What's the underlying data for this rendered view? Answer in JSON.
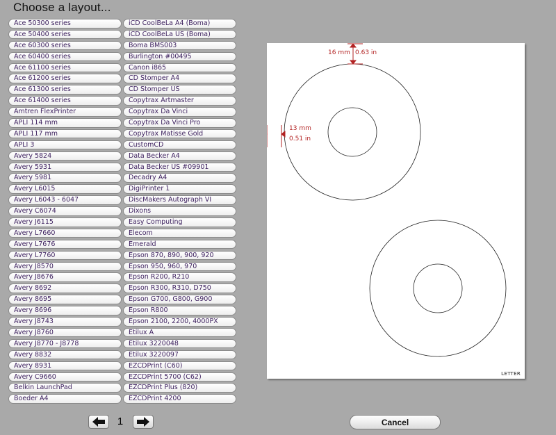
{
  "header": {
    "title": "Choose a layout..."
  },
  "layouts": {
    "column1": [
      "Ace 50300 series",
      "Ace 50400 series",
      "Ace 60300 series",
      "Ace 60400 series",
      "Ace 61100 series",
      "Ace 61200 series",
      "Ace 61300 series",
      "Ace 61400 series",
      "Amtren FlexPrinter",
      "APLI 114 mm",
      "APLI 117 mm",
      "APLI 3",
      "Avery 5824",
      "Avery 5931",
      "Avery 5981",
      "Avery L6015",
      "Avery L6043 - 6047",
      "Avery C6074",
      "Avery J6115",
      "Avery L7660",
      "Avery L7676",
      "Avery L7760",
      "Avery J8570",
      "Avery J8676",
      "Avery 8692",
      "Avery 8695",
      "Avery 8696",
      "Avery J8743",
      "Avery J8760",
      "Avery J8770 - J8778",
      "Avery 8832",
      "Avery 8931",
      "Avery C9660",
      "Belkin LaunchPad",
      "Boeder A4"
    ],
    "column2": [
      "iCD CoolBeLa A4 (Boma)",
      "iCD CoolBeLa US (Boma)",
      "Boma BMS003",
      "Burlington #00495",
      "Canon i865",
      "CD Stomper A4",
      "CD Stomper US",
      "Copytrax Artmaster",
      "Copytrax Da Vinci",
      "Copytrax Da Vinci Pro",
      "Copytrax Matisse Gold",
      "CustomCD",
      "Data Becker A4",
      "Data Becker US #09901",
      "Decadry A4",
      "DigiPrinter 1",
      "DiscMakers Autograph VI",
      "Dixons",
      "Easy Computing",
      "Elecom",
      "Emerald",
      "Epson 870, 890, 900, 920",
      "Epson 950, 960, 970",
      "Epson R200, R210",
      "Epson R300, R310, D750",
      "Epson G700, G800, G900",
      "Epson R800",
      "Epson 2100, 2200, 4000PX",
      "Etilux A",
      "Etilux 3220048",
      "Etilux 3220097",
      "EZCDPrint (C60)",
      "EZCDPrint 5700 (C62)",
      "EZCDPrint Plus (820)",
      "EZCDPrint 4200"
    ]
  },
  "preview": {
    "paper_label": "LETTER",
    "top_margin_mm": "16 mm",
    "top_margin_in": "0.63 in",
    "left_margin_mm": "13 mm",
    "left_margin_in": "0.51 in",
    "dimension_color": "#b22222"
  },
  "pagination": {
    "page_number": "1",
    "prev_icon": "arrow-left-icon",
    "next_icon": "arrow-right-icon"
  },
  "actions": {
    "cancel_label": "Cancel"
  }
}
